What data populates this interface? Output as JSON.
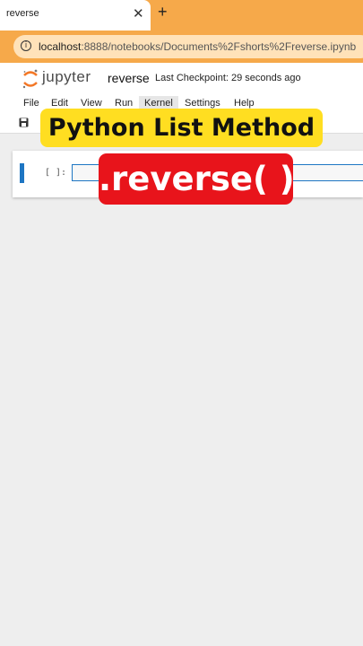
{
  "browser": {
    "tab_title": "reverse",
    "tab_close": "✕",
    "new_tab": "+",
    "url_host": "localhost",
    "url_path": ":8888/notebooks/Documents%2Fshorts%2Freverse.ipynb",
    "colors": {
      "tabbar": "#f6a94a",
      "urlbox": "#ffe2b9"
    }
  },
  "jupyter": {
    "logo_text": "jupyter",
    "notebook_name": "reverse",
    "checkpoint": "Last Checkpoint: 29 seconds ago",
    "menu": [
      "File",
      "Edit",
      "View",
      "Run",
      "Kernel",
      "Settings",
      "Help"
    ],
    "active_menu": "Kernel"
  },
  "cell": {
    "prompt": "[ ]:",
    "input_value": ""
  },
  "overlay": {
    "title": "Python List Method",
    "method": ".reverse( )",
    "colors": {
      "title_bg": "#ffde21",
      "method_bg": "#e8141b"
    }
  }
}
